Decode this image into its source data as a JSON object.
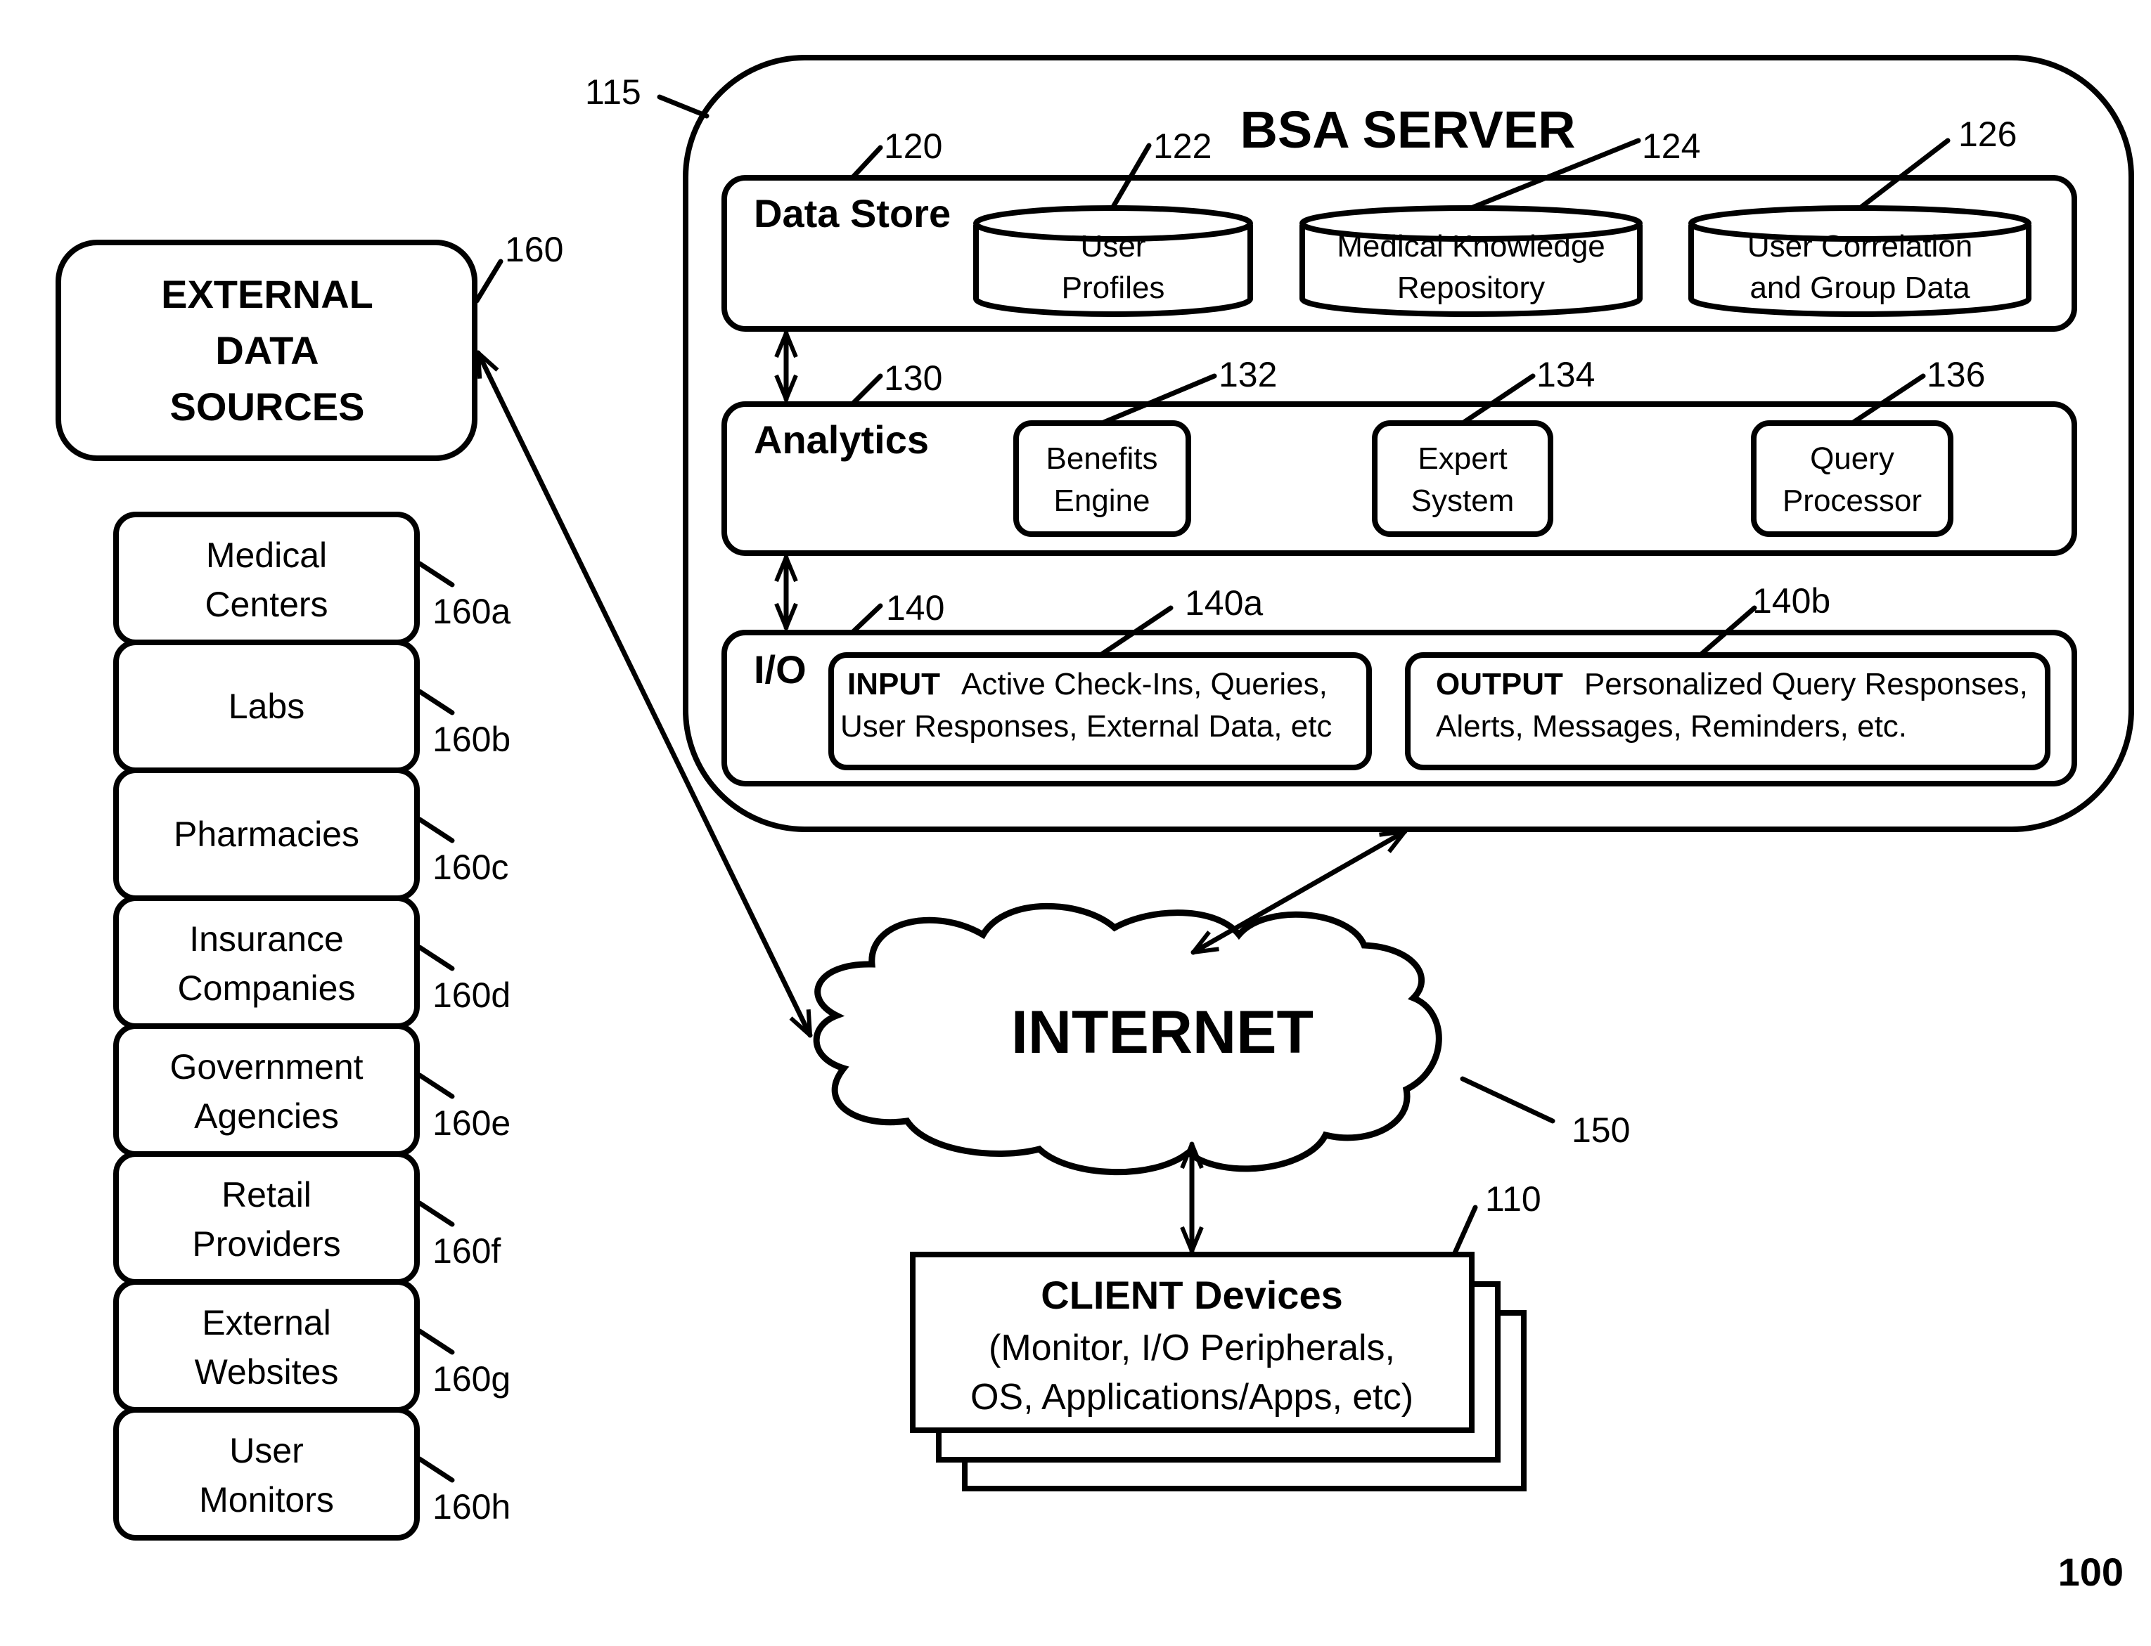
{
  "figure_number": "100",
  "server": {
    "title": "BSA SERVER",
    "ref": "115",
    "data_store": {
      "label": "Data Store",
      "ref": "120",
      "items": [
        {
          "line1": "User",
          "line2": "Profiles",
          "ref": "122"
        },
        {
          "line1": "Medical Knowledge",
          "line2": "Repository",
          "ref": "124"
        },
        {
          "line1": "User Correlation",
          "line2": "and Group Data",
          "ref": "126"
        }
      ]
    },
    "analytics": {
      "label": "Analytics",
      "ref": "130",
      "items": [
        {
          "line1": "Benefits",
          "line2": "Engine",
          "ref": "132"
        },
        {
          "line1": "Expert",
          "line2": "System",
          "ref": "134"
        },
        {
          "line1": "Query",
          "line2": "Processor",
          "ref": "136"
        }
      ]
    },
    "io": {
      "label": "I/O",
      "ref": "140",
      "input": {
        "title": "INPUT",
        "line1": "Active Check-Ins, Queries,",
        "line2": "User Responses, External Data, etc",
        "ref": "140a"
      },
      "output": {
        "title": "OUTPUT",
        "line1": "Personalized Query Responses,",
        "line2": "Alerts, Messages, Reminders, etc.",
        "ref": "140b"
      }
    }
  },
  "external": {
    "title_lines": [
      "EXTERNAL",
      "DATA",
      "SOURCES"
    ],
    "ref": "160",
    "sources": [
      {
        "line1": "Medical",
        "line2": "Centers",
        "ref": "160a"
      },
      {
        "line1": "Labs",
        "line2": "",
        "ref": "160b"
      },
      {
        "line1": "Pharmacies",
        "line2": "",
        "ref": "160c"
      },
      {
        "line1": "Insurance",
        "line2": "Companies",
        "ref": "160d"
      },
      {
        "line1": "Government",
        "line2": "Agencies",
        "ref": "160e"
      },
      {
        "line1": "Retail",
        "line2": "Providers",
        "ref": "160f"
      },
      {
        "line1": "External",
        "line2": "Websites",
        "ref": "160g"
      },
      {
        "line1": "User",
        "line2": "Monitors",
        "ref": "160h"
      }
    ]
  },
  "internet": {
    "label": "INTERNET",
    "ref": "150"
  },
  "client": {
    "title": "CLIENT Devices",
    "line1": "(Monitor, I/O Peripherals,",
    "line2": "OS, Applications/Apps, etc)",
    "ref": "110"
  }
}
